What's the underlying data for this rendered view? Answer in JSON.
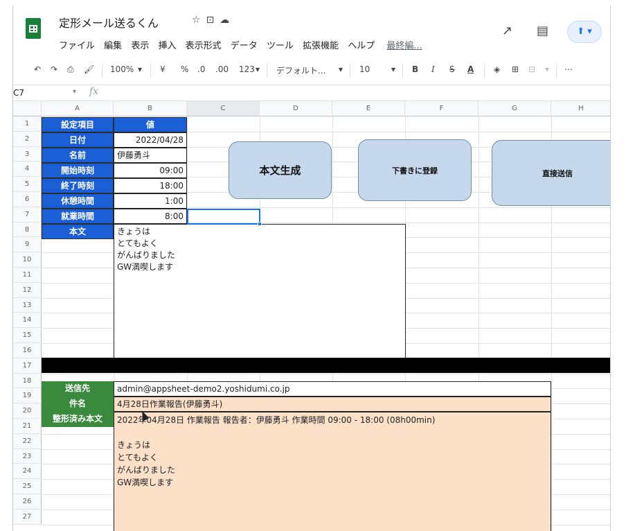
{
  "app": {
    "doc_title": "定形メール送るくん",
    "menus": [
      "ファイル",
      "編集",
      "表示",
      "挿入",
      "表示形式",
      "データ",
      "ツール",
      "拡張機能",
      "ヘルプ"
    ],
    "last_edit": "最終編..."
  },
  "toolbar": {
    "zoom": "100%",
    "currency": "¥",
    "percent": "%",
    "dec_decrease": ".0",
    "dec_increase": ".00",
    "number_format": "123",
    "font": "デフォルト...",
    "font_size": "10",
    "bold": "B",
    "italic": "I",
    "strike": "S",
    "text_color": "A"
  },
  "formula_bar": {
    "cell_ref": "C7",
    "fx": "fx",
    "value": ""
  },
  "columns": [
    "A",
    "B",
    "C",
    "D",
    "E",
    "F",
    "G",
    "H"
  ],
  "rows": [
    "1",
    "2",
    "3",
    "4",
    "5",
    "6",
    "7",
    "8",
    "9",
    "10",
    "11",
    "12",
    "13",
    "14",
    "15",
    "16",
    "17",
    "18",
    "19",
    "20",
    "21",
    "22",
    "23",
    "24",
    "25",
    "26",
    "27"
  ],
  "settings": {
    "header_label": "設定項目",
    "header_value": "値",
    "date_label": "日付",
    "date_value": "2022/04/28",
    "name_label": "名前",
    "name_value": "伊藤勇斗",
    "start_label": "開始時刻",
    "start_value": "09:00",
    "end_label": "終了時刻",
    "end_value": "18:00",
    "break_label": "休憩時間",
    "break_value": "1:00",
    "work_label": "就業時間",
    "work_value": "8:00",
    "body_label": "本文",
    "body_text": "きょうは\nとてもよく\nがんばりました\nGW満喫します"
  },
  "buttons": {
    "generate": "本文生成",
    "draft": "下書きに登録",
    "send": "直接送信"
  },
  "output": {
    "to_label": "送信先",
    "to_value": "admin@appsheet-demo2.yoshidumi.co.jp",
    "subject_label": "件名",
    "subject_value": "4月28日作業報告(伊藤勇斗)",
    "body_label": "整形済み本文",
    "body_value": "2022年04月28日 作業報告 報告者：伊藤勇斗 作業時間 09:00 - 18:00 (08h00min)\n\nきょうは\nとてもよく\nがんばりました\nGW満喫します"
  },
  "colors": {
    "label_blue": "#1a5fd6",
    "label_green": "#3a8a3e",
    "peach": "#fce0c8",
    "button_fill": "#c6d9ec",
    "sheets_green": "#188038"
  }
}
